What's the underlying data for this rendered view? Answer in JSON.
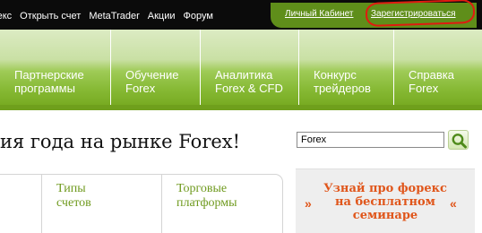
{
  "topbar": {
    "nav": [
      "Форекс",
      "Открыть счет",
      "MetaTrader",
      "Акции",
      "Форум"
    ],
    "login_label": "Личный Кабинет",
    "register_label": "Зарегистрироваться"
  },
  "menu": {
    "items": [
      {
        "label": "Партнерские\nпрограммы"
      },
      {
        "label": "Обучение\nForex"
      },
      {
        "label": "Аналитика\nForex & CFD"
      },
      {
        "label": "Конкурс\nтрейдеров"
      },
      {
        "label": "Справка\nForex"
      }
    ]
  },
  "main": {
    "headline": "ия года на рынке Forex!",
    "tabs": [
      {
        "label": "Типы\nсчетов"
      },
      {
        "label": "Торговые\nплатформы"
      }
    ]
  },
  "search": {
    "value": "Forex",
    "button_icon": "search-icon"
  },
  "promo": {
    "text": "Узнай про форекс\nна бесплатном\nсеминаре",
    "left_chevron": "»",
    "right_chevron": "«"
  },
  "colors": {
    "topbar": "#0b0b0b",
    "menu_green": "#86b934",
    "tab_text": "#6f9a1e",
    "promo_text": "#e0561b",
    "highlight": "#e01b10"
  }
}
